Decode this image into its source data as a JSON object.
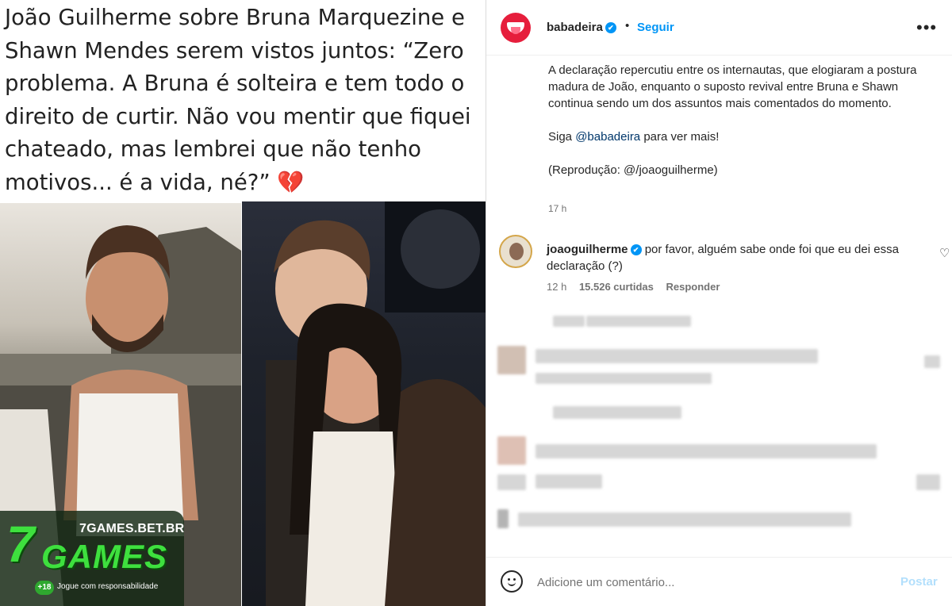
{
  "post_image": {
    "quote_text": "João Guilherme sobre Bruna Marquezine e Shawn Mendes serem vistos juntos: “Zero problema. A Bruna é solteira e tem todo o direito de curtir. Não vou mentir que fiquei chateado, mas lembrei que não tenho motivos... é a vida, né?” ",
    "quote_emoji": "💔",
    "sponsor": {
      "site": "7GAMES.BET.BR",
      "logo_numeral": "7",
      "logo_word": "GAMES",
      "age_rating": "+18",
      "tagline": "Jogue com responsabilidade"
    }
  },
  "header": {
    "username": "babadeira",
    "verified_icon": "✔",
    "separator": "•",
    "follow_label": "Seguir",
    "more_icon": "•••"
  },
  "caption": {
    "paragraph_1": "A declaração repercutiu entre os internautas, que elogiaram a postura madura de João, enquanto o suposto revival entre Bruna e Shawn continua sendo um dos assuntos mais comentados do momento.",
    "follow_prefix": "Siga ",
    "follow_mention": "@babadeira",
    "follow_suffix": " para ver mais!",
    "credit": "(Reprodução: @/joaoguilherme)",
    "time": "17 h"
  },
  "comment": {
    "username": "joaoguilherme",
    "text": " por favor, alguém sabe onde foi que eu dei essa declaração (?)",
    "time": "12 h",
    "likes": "15.526 curtidas",
    "reply_label": "Responder",
    "like_icon": "♡"
  },
  "footer": {
    "placeholder": "Adicione um comentário...",
    "post_label": "Postar"
  },
  "colors": {
    "accent": "#0095f6",
    "brand_red": "#e61e3c",
    "sponsor_green": "#3ee03e"
  }
}
